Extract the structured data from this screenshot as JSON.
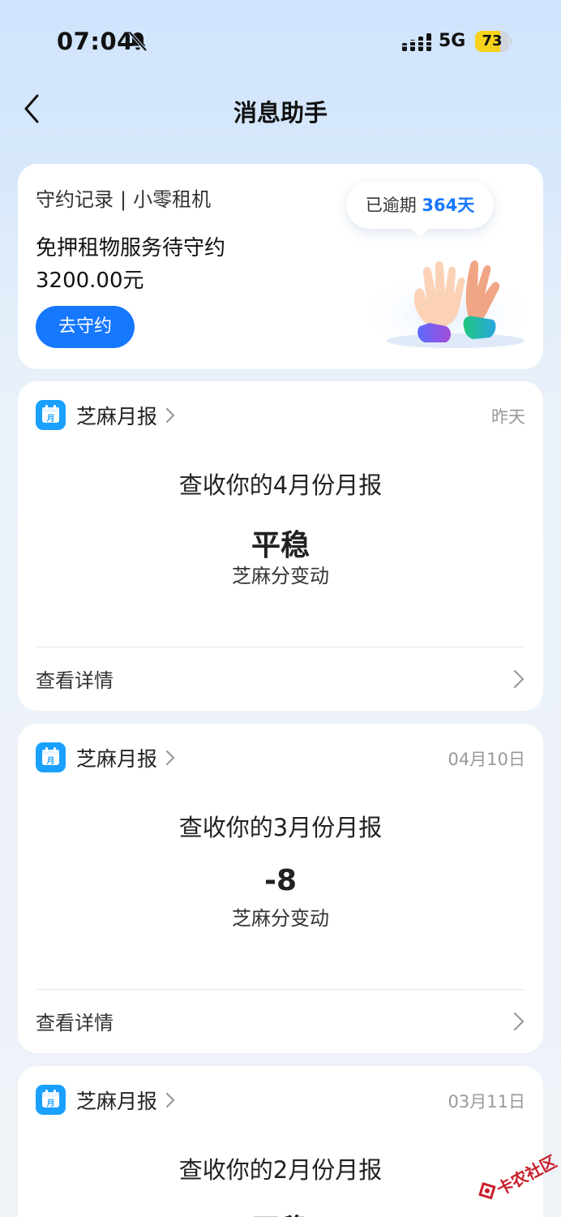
{
  "status_bar": {
    "time": "07:04",
    "network": "5G",
    "battery_level": "73"
  },
  "nav": {
    "title": "消息助手"
  },
  "promise_card": {
    "header_record": "守约记录",
    "header_separator": "|",
    "header_app": "小零租机",
    "description": "免押租物服务待守约3200.00元",
    "button_label": "去守约",
    "overdue_prefix": "已逾期",
    "overdue_days": "364天"
  },
  "reports": [
    {
      "source": "芝麻月报",
      "date": "昨天",
      "title": "查收你的4月份月报",
      "value": "平稳",
      "subtitle": "芝麻分变动",
      "link": "查看详情"
    },
    {
      "source": "芝麻月报",
      "date": "04月10日",
      "title": "查收你的3月份月报",
      "value": "-8",
      "subtitle": "芝麻分变动",
      "link": "查看详情"
    },
    {
      "source": "芝麻月报",
      "date": "03月11日",
      "title": "查收你的2月份月报",
      "value": "平稳",
      "subtitle": "",
      "link": ""
    }
  ],
  "watermark": {
    "text": "卡农社区"
  },
  "colors": {
    "accent": "#1677ff",
    "battery": "#f7d21a",
    "background_top": "#cfe4fd"
  }
}
